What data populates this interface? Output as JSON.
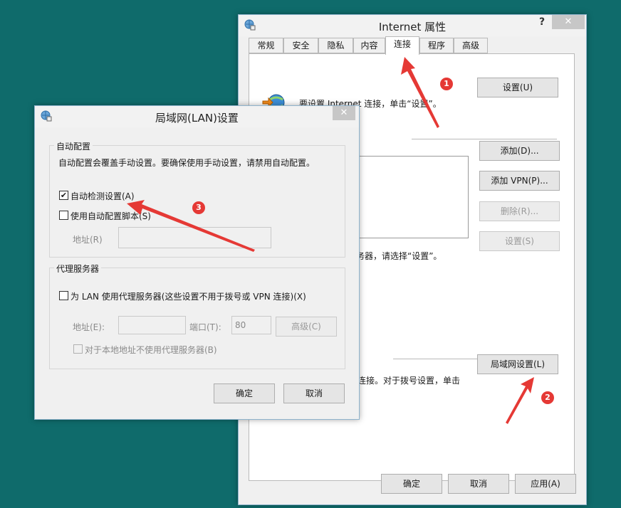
{
  "internet_props": {
    "title": "Internet 属性",
    "help": "?",
    "close": "✕",
    "tabs": [
      "常规",
      "安全",
      "隐私",
      "内容",
      "连接",
      "程序",
      "高级"
    ],
    "setup_text": "要设置 Internet 连接，单击“设置”。",
    "setup_button": "设置(U)",
    "add_button": "添加(D)...",
    "add_vpn_button": "添加 VPN(P)...",
    "delete_button": "删除(R)...",
    "settings_button": "设置(S)",
    "proxy_hint": "务器，请选择“设置”。",
    "lan_hint": "连接。对于拨号设置，单击",
    "lan_button": "局域网设置(L)",
    "ok": "确定",
    "cancel": "取消",
    "apply": "应用(A)"
  },
  "lan_dialog": {
    "title": "局域网(LAN)设置",
    "close": "✕",
    "auto_group_title": "自动配置",
    "auto_desc": "自动配置会覆盖手动设置。要确保使用手动设置，请禁用自动配置。",
    "auto_detect_label": "自动检测设置(A)",
    "auto_detect_checked": true,
    "auto_script_label": "使用自动配置脚本(S)",
    "address_label": "地址(R)",
    "proxy_group_title": "代理服务器",
    "proxy_use_label": "为 LAN 使用代理服务器(这些设置不用于拨号或 VPN 连接)(X)",
    "proxy_address_label": "地址(E):",
    "port_label": "端口(T):",
    "port_value": "80",
    "advanced_button": "高级(C)",
    "bypass_label": "对于本地地址不使用代理服务器(B)",
    "ok": "确定",
    "cancel": "取消"
  },
  "annotations": {
    "badge1": "1",
    "badge2": "2",
    "badge3": "3",
    "arrow_color": "#e53935"
  }
}
